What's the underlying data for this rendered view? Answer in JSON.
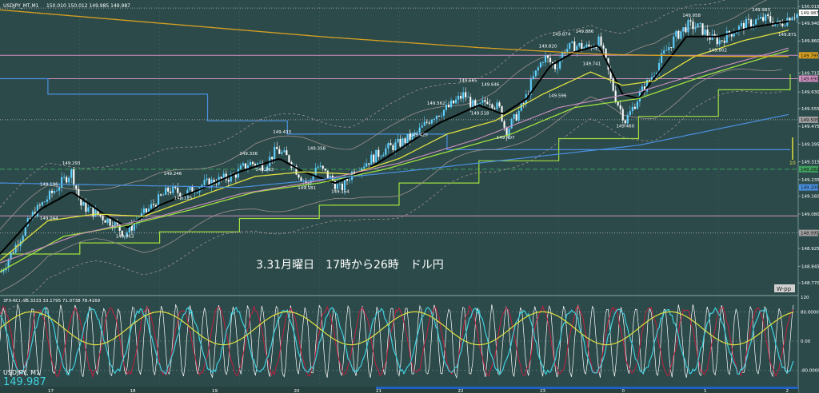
{
  "header": {
    "symbol_line": "USDJPY_MT,M1",
    "ohlc": "150.010 150.012 149.985 149.987"
  },
  "annotation": "3.31月曜日　17時から26時　ドル円",
  "symbol_footer": "USDJPY, M1",
  "current_price": "149.987",
  "wpp_label": "W-pp",
  "vertical_marker_label": "10",
  "indicator_header": "3FX-RCI -98.3333 33.1795 71.0738 78.4169",
  "colors": {
    "background": "#2c4a4a",
    "grid": "#3f6060",
    "bull": "#5fd0ff",
    "bear": "#ffffff",
    "ma_black": "#000000",
    "ma_yellow": "#e0e040",
    "ma_green": "#a0e040",
    "ma_pink": "#d090c0",
    "ma_orange": "#d8a020",
    "line_blue": "#4a90e0",
    "bb_gray": "#a09090",
    "rci_white": "#ffffff",
    "rci_cyan": "#40d0e0",
    "rci_red": "#c02040",
    "rci_yellow": "#e0e040"
  },
  "chart_data": {
    "type": "line",
    "subtype": "candlestick",
    "title": "",
    "price_axis_ticks": [
      "150.015",
      "149.940",
      "149.860",
      "149.790",
      "149.715",
      "149.630",
      "149.555",
      "149.475",
      "149.395",
      "149.315",
      "149.235",
      "149.160",
      "149.080",
      "149.000",
      "148.925",
      "148.845",
      "148.770"
    ],
    "price_axis_tags": [
      {
        "value": "149.987",
        "color": "#ffffff"
      },
      {
        "value": "149.795",
        "color": "#d8a020"
      },
      {
        "value": "149.690",
        "color": "#d090c0"
      },
      {
        "value": "149.505",
        "color": "#a0a0a0"
      },
      {
        "value": "149.282",
        "color": "#40a060"
      },
      {
        "value": "149.200",
        "color": "#4a90e0"
      },
      {
        "value": "148.995",
        "color": "#a0a0a0"
      }
    ],
    "time_axis_labels": [
      "17",
      "18",
      "19",
      "20",
      "21",
      "22",
      "23",
      "0",
      "1",
      "2"
    ],
    "ylim": [
      148.72,
      150.03
    ],
    "price_labels": [
      {
        "x": 0.06,
        "y": 149.196,
        "t": "149.196"
      },
      {
        "x": 0.088,
        "y": 149.293,
        "t": "149.293"
      },
      {
        "x": 0.06,
        "y": 149.044,
        "t": "149.044"
      },
      {
        "x": 0.155,
        "y": 148.963,
        "t": "148.963"
      },
      {
        "x": 0.215,
        "y": 149.246,
        "t": "149.246"
      },
      {
        "x": 0.228,
        "y": 149.135,
        "t": "149.135"
      },
      {
        "x": 0.31,
        "y": 149.336,
        "t": "149.336"
      },
      {
        "x": 0.33,
        "y": 149.263,
        "t": "149.263"
      },
      {
        "x": 0.352,
        "y": 149.433,
        "t": "149.433"
      },
      {
        "x": 0.395,
        "y": 149.358,
        "t": "149.358"
      },
      {
        "x": 0.383,
        "y": 149.181,
        "t": "149.181"
      },
      {
        "x": 0.425,
        "y": 149.164,
        "t": "149.164"
      },
      {
        "x": 0.523,
        "y": 149.42,
        "t": "149.420"
      },
      {
        "x": 0.545,
        "y": 149.562,
        "t": "149.562"
      },
      {
        "x": 0.585,
        "y": 149.665,
        "t": "149.665"
      },
      {
        "x": 0.6,
        "y": 149.518,
        "t": "149.518"
      },
      {
        "x": 0.613,
        "y": 149.646,
        "t": "149.646"
      },
      {
        "x": 0.632,
        "y": 149.407,
        "t": "149.407"
      },
      {
        "x": 0.685,
        "y": 149.82,
        "t": "149.820"
      },
      {
        "x": 0.697,
        "y": 149.596,
        "t": "149.596"
      },
      {
        "x": 0.702,
        "y": 149.874,
        "t": "149.874"
      },
      {
        "x": 0.731,
        "y": 149.886,
        "t": "149.886"
      },
      {
        "x": 0.74,
        "y": 149.741,
        "t": "149.741"
      },
      {
        "x": 0.782,
        "y": 149.46,
        "t": "149.460"
      },
      {
        "x": 0.865,
        "y": 149.958,
        "t": "149.958"
      },
      {
        "x": 0.898,
        "y": 149.802,
        "t": "149.802"
      },
      {
        "x": 0.952,
        "y": 149.983,
        "t": "149.983"
      },
      {
        "x": 0.985,
        "y": 149.871,
        "t": "149.871"
      }
    ],
    "price_path": [
      [
        0.0,
        148.82
      ],
      [
        0.02,
        148.95
      ],
      [
        0.04,
        149.08
      ],
      [
        0.06,
        149.16
      ],
      [
        0.075,
        149.22
      ],
      [
        0.088,
        149.27
      ],
      [
        0.1,
        149.12
      ],
      [
        0.12,
        149.08
      ],
      [
        0.14,
        149.04
      ],
      [
        0.155,
        148.99
      ],
      [
        0.17,
        149.05
      ],
      [
        0.19,
        149.12
      ],
      [
        0.21,
        149.19
      ],
      [
        0.23,
        149.17
      ],
      [
        0.25,
        149.21
      ],
      [
        0.27,
        149.23
      ],
      [
        0.29,
        149.25
      ],
      [
        0.31,
        149.31
      ],
      [
        0.33,
        149.3
      ],
      [
        0.345,
        149.37
      ],
      [
        0.36,
        149.33
      ],
      [
        0.375,
        149.25
      ],
      [
        0.385,
        149.21
      ],
      [
        0.395,
        149.3
      ],
      [
        0.41,
        149.25
      ],
      [
        0.425,
        149.19
      ],
      [
        0.44,
        149.27
      ],
      [
        0.46,
        149.32
      ],
      [
        0.48,
        149.37
      ],
      [
        0.5,
        149.4
      ],
      [
        0.52,
        149.44
      ],
      [
        0.54,
        149.52
      ],
      [
        0.56,
        149.56
      ],
      [
        0.58,
        149.62
      ],
      [
        0.595,
        149.55
      ],
      [
        0.61,
        149.6
      ],
      [
        0.625,
        149.55
      ],
      [
        0.632,
        149.45
      ],
      [
        0.645,
        149.52
      ],
      [
        0.655,
        149.58
      ],
      [
        0.665,
        149.68
      ],
      [
        0.68,
        149.79
      ],
      [
        0.695,
        149.74
      ],
      [
        0.705,
        149.82
      ],
      [
        0.72,
        149.84
      ],
      [
        0.735,
        149.83
      ],
      [
        0.75,
        149.86
      ],
      [
        0.76,
        149.73
      ],
      [
        0.77,
        149.6
      ],
      [
        0.782,
        149.5
      ],
      [
        0.79,
        149.55
      ],
      [
        0.8,
        149.62
      ],
      [
        0.815,
        149.7
      ],
      [
        0.83,
        149.8
      ],
      [
        0.845,
        149.88
      ],
      [
        0.86,
        149.93
      ],
      [
        0.875,
        149.92
      ],
      [
        0.89,
        149.87
      ],
      [
        0.9,
        149.86
      ],
      [
        0.915,
        149.9
      ],
      [
        0.93,
        149.93
      ],
      [
        0.945,
        149.95
      ],
      [
        0.96,
        149.96
      ],
      [
        0.975,
        149.93
      ],
      [
        0.99,
        149.98
      ]
    ],
    "series": [
      {
        "style": "ma_black",
        "values": [
          [
            0.0,
            148.9
          ],
          [
            0.05,
            149.1
          ],
          [
            0.09,
            149.18
          ],
          [
            0.13,
            149.08
          ],
          [
            0.16,
            149.02
          ],
          [
            0.2,
            149.12
          ],
          [
            0.25,
            149.19
          ],
          [
            0.3,
            149.27
          ],
          [
            0.35,
            149.33
          ],
          [
            0.38,
            149.27
          ],
          [
            0.42,
            149.22
          ],
          [
            0.46,
            149.28
          ],
          [
            0.5,
            149.37
          ],
          [
            0.55,
            149.49
          ],
          [
            0.6,
            149.57
          ],
          [
            0.63,
            149.53
          ],
          [
            0.66,
            149.6
          ],
          [
            0.69,
            149.75
          ],
          [
            0.72,
            149.81
          ],
          [
            0.75,
            149.84
          ],
          [
            0.78,
            149.62
          ],
          [
            0.8,
            149.6
          ],
          [
            0.83,
            149.74
          ],
          [
            0.86,
            149.88
          ],
          [
            0.9,
            149.88
          ],
          [
            0.94,
            149.92
          ],
          [
            0.99,
            149.95
          ]
        ]
      },
      {
        "style": "ma_yellow",
        "values": [
          [
            0.0,
            148.87
          ],
          [
            0.06,
            149.05
          ],
          [
            0.12,
            149.08
          ],
          [
            0.18,
            149.07
          ],
          [
            0.25,
            149.16
          ],
          [
            0.32,
            149.25
          ],
          [
            0.38,
            149.27
          ],
          [
            0.44,
            149.26
          ],
          [
            0.5,
            149.33
          ],
          [
            0.56,
            149.44
          ],
          [
            0.62,
            149.5
          ],
          [
            0.68,
            149.62
          ],
          [
            0.74,
            149.72
          ],
          [
            0.78,
            149.66
          ],
          [
            0.82,
            149.68
          ],
          [
            0.87,
            149.79
          ],
          [
            0.93,
            149.86
          ],
          [
            0.99,
            149.91
          ]
        ]
      },
      {
        "style": "ma_green",
        "values": [
          [
            0.0,
            148.82
          ],
          [
            0.08,
            148.98
          ],
          [
            0.16,
            149.03
          ],
          [
            0.24,
            149.1
          ],
          [
            0.32,
            149.18
          ],
          [
            0.4,
            149.22
          ],
          [
            0.48,
            149.28
          ],
          [
            0.56,
            149.36
          ],
          [
            0.64,
            149.44
          ],
          [
            0.72,
            149.56
          ],
          [
            0.8,
            149.6
          ],
          [
            0.88,
            149.7
          ],
          [
            0.99,
            149.82
          ]
        ]
      },
      {
        "style": "ma_pink",
        "values": [
          [
            0.0,
            148.86
          ],
          [
            0.1,
            148.99
          ],
          [
            0.2,
            149.07
          ],
          [
            0.3,
            149.17
          ],
          [
            0.4,
            149.23
          ],
          [
            0.5,
            149.31
          ],
          [
            0.6,
            149.42
          ],
          [
            0.7,
            149.56
          ],
          [
            0.8,
            149.63
          ],
          [
            0.9,
            149.74
          ],
          [
            0.99,
            149.83
          ]
        ]
      },
      {
        "style": "ma_orange",
        "values": [
          [
            0.0,
            150.0
          ],
          [
            0.2,
            149.94
          ],
          [
            0.4,
            149.88
          ],
          [
            0.6,
            149.83
          ],
          [
            0.75,
            149.8
          ],
          [
            0.9,
            149.79
          ],
          [
            0.99,
            149.79
          ]
        ]
      },
      {
        "style": "line_blue",
        "values": [
          [
            0.0,
            149.22
          ],
          [
            0.3,
            149.2
          ],
          [
            0.5,
            149.27
          ],
          [
            0.65,
            149.33
          ],
          [
            0.8,
            149.39
          ],
          [
            0.99,
            149.53
          ]
        ]
      }
    ],
    "horizontal_lines": [
      {
        "y": 149.795,
        "color": "#d090c0",
        "style": "solid",
        "name": "pink"
      },
      {
        "y": 149.69,
        "color": "#d090c0",
        "style": "solid",
        "name": "pink2"
      },
      {
        "y": 149.072,
        "color": "#d090c0",
        "style": "solid",
        "name": "pink3"
      },
      {
        "y": 149.282,
        "color": "#40a060",
        "style": "dashed",
        "name": "green"
      },
      {
        "y": 149.505,
        "color": "#a0a0a0",
        "style": "dotted",
        "name": "gray1"
      },
      {
        "y": 148.995,
        "color": "#a0a0a0",
        "style": "dotted",
        "name": "gray2"
      },
      {
        "y": 150.008,
        "color": "#a0a0a0",
        "style": "dotted",
        "name": "gray3"
      }
    ],
    "step_lines": [
      {
        "color": "#4a90e0",
        "values": [
          [
            0.0,
            149.69
          ],
          [
            0.06,
            149.69
          ],
          [
            0.06,
            149.62
          ],
          [
            0.26,
            149.62
          ],
          [
            0.26,
            149.5
          ],
          [
            0.36,
            149.5
          ],
          [
            0.36,
            149.44
          ],
          [
            0.56,
            149.44
          ],
          [
            0.56,
            149.37
          ],
          [
            0.99,
            149.37
          ]
        ]
      },
      {
        "color": "#a0e040",
        "values": [
          [
            0.0,
            148.9
          ],
          [
            0.1,
            148.9
          ],
          [
            0.1,
            148.95
          ],
          [
            0.2,
            148.95
          ],
          [
            0.2,
            149.0
          ],
          [
            0.3,
            149.0
          ],
          [
            0.3,
            149.06
          ],
          [
            0.4,
            149.06
          ],
          [
            0.4,
            149.12
          ],
          [
            0.5,
            149.12
          ],
          [
            0.5,
            149.22
          ],
          [
            0.6,
            149.22
          ],
          [
            0.6,
            149.32
          ],
          [
            0.7,
            149.32
          ],
          [
            0.7,
            149.42
          ],
          [
            0.8,
            149.42
          ],
          [
            0.8,
            149.52
          ],
          [
            0.9,
            149.52
          ],
          [
            0.9,
            149.64
          ],
          [
            0.99,
            149.64
          ],
          [
            0.99,
            149.71
          ]
        ]
      }
    ],
    "indicator": {
      "name": "3FX-RCI",
      "values": [
        "-98.3333",
        "33.1795",
        "71.0738",
        "78.4169"
      ],
      "ylim": [
        -120,
        120
      ],
      "levels": [
        "120",
        "80.0000",
        "0.00",
        "-80.0000"
      ]
    }
  }
}
